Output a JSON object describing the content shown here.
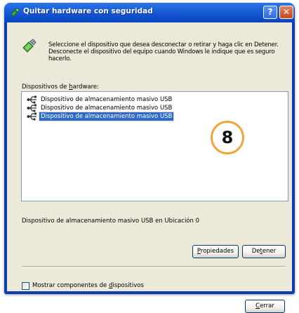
{
  "window": {
    "title": "Quitar hardware con seguridad",
    "help_label": "?",
    "close_label": "✕"
  },
  "intro_text": "Seleccione el dispositivo que desea desconectar o retirar y haga clic en Detener. Desconecte el dispositivo del equipo cuando Windows le indique que es seguro hacerlo.",
  "hardware_devices": {
    "label_pre": "Dispositivos de ",
    "label_accel": "h",
    "label_post": "ardware:",
    "items": [
      {
        "label": "Dispositivo de almacenamiento masivo USB",
        "selected": false
      },
      {
        "label": "Dispositivo de almacenamiento masivo USB",
        "selected": false
      },
      {
        "label": "Dispositivo de almacenamiento masivo USB",
        "selected": true
      }
    ]
  },
  "callout_number": "8",
  "status_text": "Dispositivo de almacenamiento masivo USB en Ubicación 0",
  "buttons": {
    "properties": {
      "accel": "P",
      "rest": "ropiedades"
    },
    "stop": {
      "pre": "De",
      "accel": "t",
      "post": "ener"
    },
    "close": {
      "accel": "C",
      "rest": "errar"
    }
  },
  "show_components": {
    "pre": "Mostrar componentes de ",
    "accel": "d",
    "post": "ispositivos",
    "checked": false
  },
  "icons": [
    "usb-device-icon",
    "remove-hardware-icon",
    "help-icon",
    "close-icon"
  ],
  "colors": {
    "title_bar": "#0f4cc9",
    "selection": "#316ac5",
    "callout_ring": "#f0a43c",
    "dialog_bg": "#ece9d8"
  }
}
